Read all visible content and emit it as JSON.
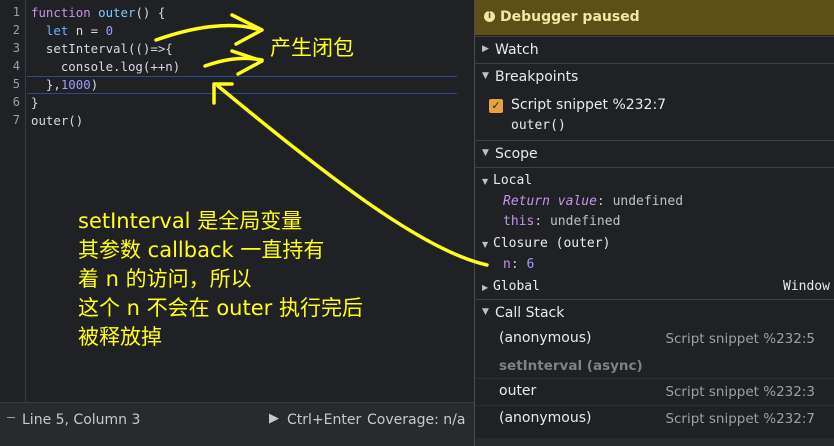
{
  "editor": {
    "line_numbers": [
      "1",
      "2",
      "3",
      "4",
      "5",
      "6",
      "7"
    ],
    "lines": [
      [
        {
          "t": "function ",
          "c": "kw"
        },
        {
          "t": "outer",
          "c": "fn"
        },
        {
          "t": "() {",
          "c": "plain"
        }
      ],
      [
        {
          "t": "  let ",
          "c": "kw2"
        },
        {
          "t": "n = ",
          "c": "plain"
        },
        {
          "t": "0",
          "c": "num"
        }
      ],
      [
        {
          "t": "  setInterval(()=>{",
          "c": "plain"
        }
      ],
      [
        {
          "t": "    console.log(++n)",
          "c": "plain"
        }
      ],
      [
        {
          "t": "  },",
          "c": "plain"
        },
        {
          "t": "1000",
          "c": "num"
        },
        {
          "t": ")",
          "c": "plain"
        }
      ],
      [
        {
          "t": "}",
          "c": "plain"
        }
      ],
      [
        {
          "t": "outer()",
          "c": "plain"
        }
      ]
    ]
  },
  "statusbar": {
    "position": "Line 5, Column 3",
    "run": "Ctrl+Enter",
    "coverage": "Coverage: n/a"
  },
  "debugger": {
    "paused": "Debugger paused",
    "watch": "Watch",
    "breakpoints": "Breakpoints",
    "breakpoint_label": "Script snippet %232:7",
    "breakpoint_code": "outer()",
    "scope": "Scope",
    "local": "Local",
    "return_name": "Return value",
    "return_val": "undefined",
    "this_name": "this",
    "this_val": "undefined",
    "closure": "Closure (outer)",
    "n_name": "n",
    "n_val": "6",
    "global": "Global",
    "global_val": "Window",
    "call_stack": "Call Stack",
    "stack": [
      {
        "name": "(anonymous)",
        "loc": "Script snippet %232:5"
      },
      {
        "name": "outer",
        "loc": "Script snippet %232:3"
      },
      {
        "name": "(anonymous)",
        "loc": "Script snippet %232:7"
      }
    ],
    "async_label": "setInterval (async)"
  },
  "annotations": {
    "closure_note": "产生闭包",
    "main_note": "setInterval 是全局变量\n其参数 callback 一直持有\n着 n 的访问，所以\n这个 n 不会在 outer 执行完后\n被释放掉"
  },
  "colors": {
    "annotation": "#ffff1a",
    "paused_bar": "#5c5016",
    "checkbox": "#e8a23b"
  }
}
